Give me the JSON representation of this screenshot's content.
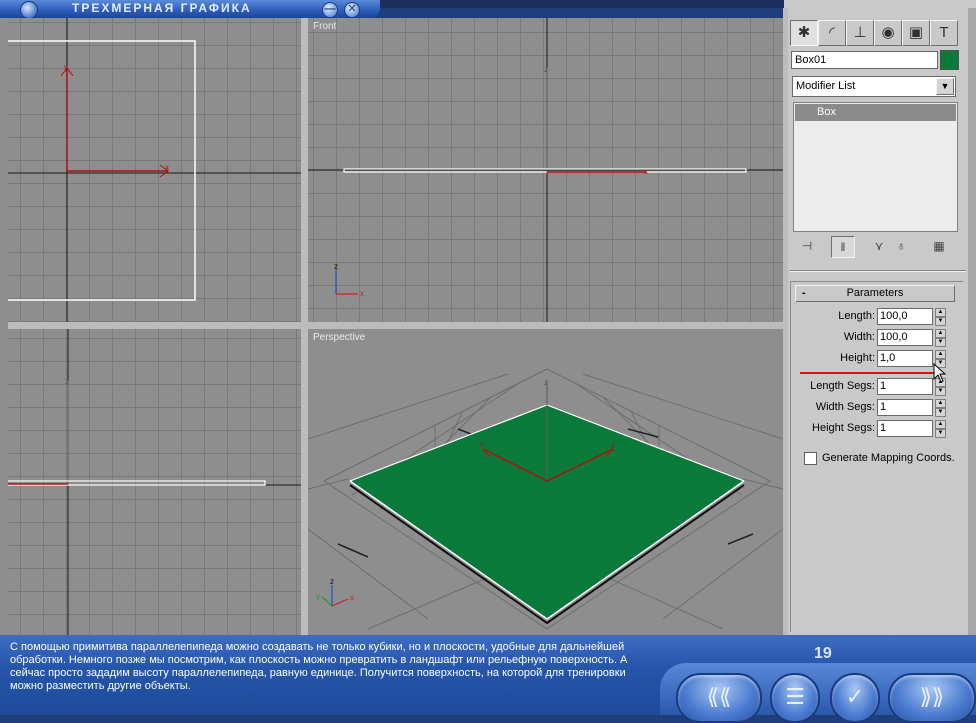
{
  "window": {
    "title": "ТРЕХМЕРНАЯ ГРАФИКА",
    "minimize_glyph": "—",
    "close_glyph": "✕"
  },
  "viewports": {
    "front": {
      "label": "Front"
    },
    "perspective": {
      "label": "Perspective"
    }
  },
  "axes": {
    "x": "x",
    "y": "y",
    "z": "z"
  },
  "command_panel": {
    "tabs": [
      {
        "icon": "create-icon",
        "glyph": "✱"
      },
      {
        "icon": "modify-icon",
        "glyph": "◜"
      },
      {
        "icon": "hierarchy-icon",
        "glyph": "⊥"
      },
      {
        "icon": "motion-icon",
        "glyph": "◉"
      },
      {
        "icon": "display-icon",
        "glyph": "▣"
      },
      {
        "icon": "utilities-icon",
        "glyph": "T"
      }
    ],
    "object_name": "Box01",
    "object_color": "#0a7a3a",
    "modifier_list": "Modifier List",
    "stack_items": [
      "Box"
    ],
    "parameters": {
      "header": "Parameters",
      "collapse_glyph": "-",
      "length_label": "Length:",
      "length_value": "100,0",
      "width_label": "Width:",
      "width_value": "100,0",
      "height_label": "Height:",
      "height_value": "1,0",
      "length_segs_label": "Length Segs:",
      "length_segs_value": "1",
      "width_segs_label": "Width Segs:",
      "width_segs_value": "1",
      "height_segs_label": "Height Segs:",
      "height_segs_value": "1",
      "mapping_label": "Generate Mapping Coords."
    }
  },
  "lesson": {
    "description": "С помощью примитива параллелепипеда можно создавать не только кубики, но и плоскости, удобные для дальнейшей обработки. Немного позже мы посмотрим, как плоскость можно превратить в ландшафт или рельефную поверхность. А сейчас просто зададим высоту параллелепипеда, равную единице. Получится поверхность, на которой для тренировки можно разместить другие объекты.",
    "page_number": "19"
  }
}
